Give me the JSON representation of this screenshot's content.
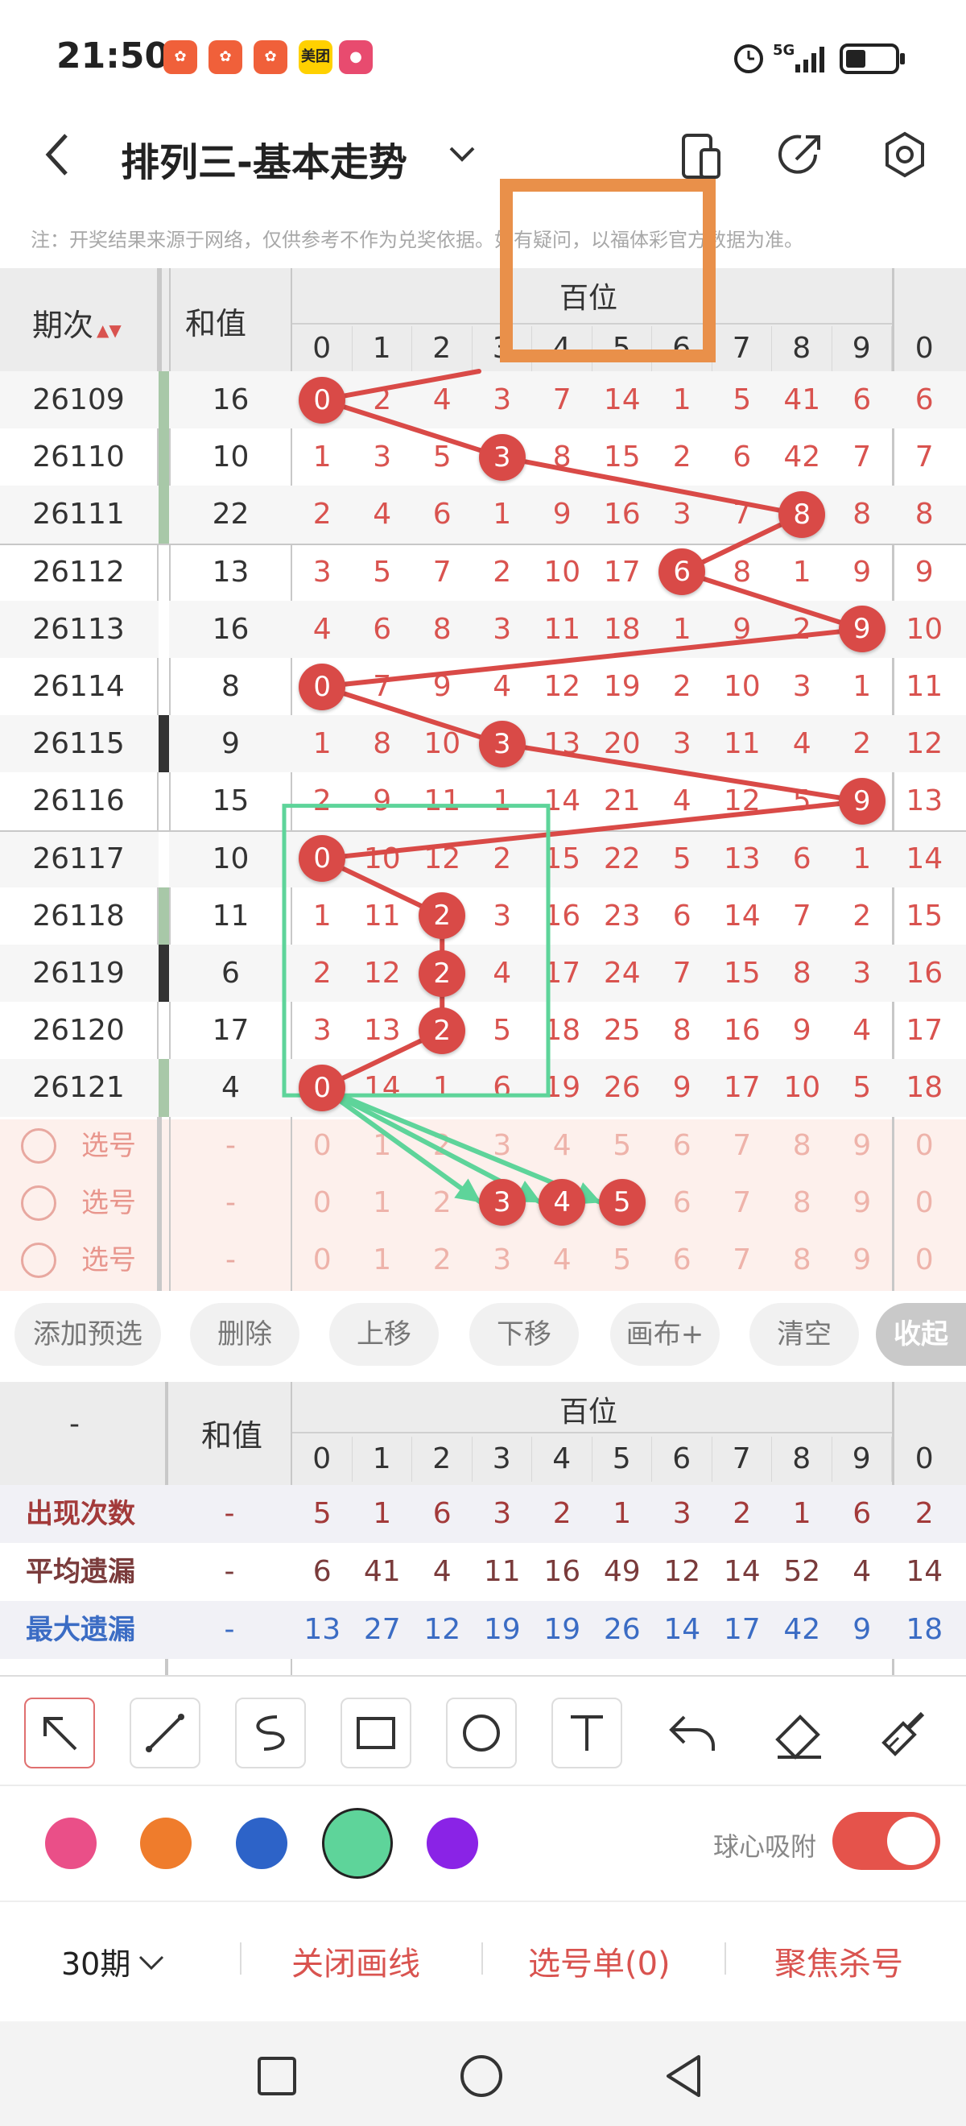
{
  "status_bar": {
    "time": "21:50",
    "app_icons": [
      "app-icon",
      "app-icon",
      "app-icon",
      "meituan-icon",
      "balloon-icon"
    ],
    "meituan_label": "美团",
    "network": "5G",
    "icons": [
      "alarm-icon",
      "signal-icon",
      "battery-icon"
    ]
  },
  "header": {
    "title": "排列三-基本走势",
    "icons": [
      "back-icon",
      "chevron-down-icon",
      "phone-icon",
      "share-icon",
      "settings-icon"
    ]
  },
  "notice": "注：开奖结果来源于网络，仅供参考不作为兑奖依据。如有疑问，以福体彩官方数据为准。",
  "table": {
    "col_period": "期次",
    "col_sum": "和值",
    "group_title": "百位",
    "digits": [
      "0",
      "1",
      "2",
      "3",
      "4",
      "5",
      "6",
      "7",
      "8",
      "9"
    ],
    "next_digit": "0",
    "rows": [
      {
        "period": "26109",
        "sum": "16",
        "cells": [
          "0",
          "2",
          "4",
          "3",
          "7",
          "14",
          "1",
          "5",
          "41",
          "6"
        ],
        "next": "6",
        "hit": 0
      },
      {
        "period": "26110",
        "sum": "10",
        "cells": [
          "1",
          "3",
          "5",
          "3",
          "8",
          "15",
          "2",
          "6",
          "42",
          "7"
        ],
        "next": "7",
        "hit": 3
      },
      {
        "period": "26111",
        "sum": "22",
        "cells": [
          "2",
          "4",
          "6",
          "1",
          "9",
          "16",
          "3",
          "7",
          "8",
          "8"
        ],
        "next": "8",
        "hit": 8
      },
      {
        "period": "26112",
        "sum": "13",
        "cells": [
          "3",
          "5",
          "7",
          "2",
          "10",
          "17",
          "6",
          "8",
          "1",
          "9"
        ],
        "next": "9",
        "hit": 6
      },
      {
        "period": "26113",
        "sum": "16",
        "cells": [
          "4",
          "6",
          "8",
          "3",
          "11",
          "18",
          "1",
          "9",
          "2",
          "9"
        ],
        "next": "10",
        "hit": 9
      },
      {
        "period": "26114",
        "sum": "8",
        "cells": [
          "0",
          "7",
          "9",
          "4",
          "12",
          "19",
          "2",
          "10",
          "3",
          "1"
        ],
        "next": "11",
        "hit": 0
      },
      {
        "period": "26115",
        "sum": "9",
        "cells": [
          "1",
          "8",
          "10",
          "3",
          "13",
          "20",
          "3",
          "11",
          "4",
          "2"
        ],
        "next": "12",
        "hit": 3
      },
      {
        "period": "26116",
        "sum": "15",
        "cells": [
          "2",
          "9",
          "11",
          "1",
          "14",
          "21",
          "4",
          "12",
          "5",
          "9"
        ],
        "next": "13",
        "hit": 9
      },
      {
        "period": "26117",
        "sum": "10",
        "cells": [
          "0",
          "10",
          "12",
          "2",
          "15",
          "22",
          "5",
          "13",
          "6",
          "1"
        ],
        "next": "14",
        "hit": 0
      },
      {
        "period": "26118",
        "sum": "11",
        "cells": [
          "1",
          "11",
          "2",
          "3",
          "16",
          "23",
          "6",
          "14",
          "7",
          "2"
        ],
        "next": "15",
        "hit": 2
      },
      {
        "period": "26119",
        "sum": "6",
        "cells": [
          "2",
          "12",
          "2",
          "4",
          "17",
          "24",
          "7",
          "15",
          "8",
          "3"
        ],
        "next": "16",
        "hit": 2
      },
      {
        "period": "26120",
        "sum": "17",
        "cells": [
          "3",
          "13",
          "2",
          "5",
          "18",
          "25",
          "8",
          "16",
          "9",
          "4"
        ],
        "next": "17",
        "hit": 2
      },
      {
        "period": "26121",
        "sum": "4",
        "cells": [
          "0",
          "14",
          "1",
          "6",
          "19",
          "26",
          "9",
          "17",
          "10",
          "5"
        ],
        "next": "18",
        "hit": 0
      }
    ],
    "select_rows": [
      {
        "label": "选号",
        "sum": "-",
        "picked": []
      },
      {
        "label": "选号",
        "sum": "-",
        "picked": [
          "3",
          "4",
          "5"
        ]
      },
      {
        "label": "选号",
        "sum": "-",
        "picked": []
      }
    ]
  },
  "buttons": [
    "添加预选",
    "删除",
    "上移",
    "下移",
    "画布+",
    "清空",
    "收起"
  ],
  "stats": {
    "corner": "-",
    "col_sum": "和值",
    "group_title": "百位",
    "rows": [
      {
        "label": "出现次数",
        "sum": "-",
        "values": [
          "5",
          "1",
          "6",
          "3",
          "2",
          "1",
          "3",
          "2",
          "1",
          "6"
        ],
        "next": "2",
        "color": "#a33a3a"
      },
      {
        "label": "平均遗漏",
        "sum": "-",
        "values": [
          "6",
          "41",
          "4",
          "11",
          "16",
          "49",
          "12",
          "14",
          "52",
          "4"
        ],
        "next": "14",
        "color": "#7a3b3b"
      },
      {
        "label": "最大遗漏",
        "sum": "-",
        "values": [
          "13",
          "27",
          "12",
          "19",
          "19",
          "26",
          "14",
          "17",
          "42",
          "9"
        ],
        "next": "18",
        "color": "#3b6cc4"
      }
    ]
  },
  "toolbar": {
    "tools": [
      "pointer-icon",
      "line-icon",
      "curve-icon",
      "rectangle-icon",
      "circle-icon",
      "text-icon",
      "undo-icon",
      "eraser-icon",
      "brush-icon"
    ]
  },
  "palette": {
    "colors": [
      "#ea4f88",
      "#ef7c2c",
      "#2d63c8",
      "#5ed49a",
      "#8a23e6"
    ],
    "snap_label": "球心吸附",
    "snap_on": true,
    "accent": "#e5534b"
  },
  "bottom": {
    "period_select": "30期",
    "close_line": "关闭画线",
    "pick_list": "选号单(0)",
    "focus_kill": "聚焦杀号"
  }
}
